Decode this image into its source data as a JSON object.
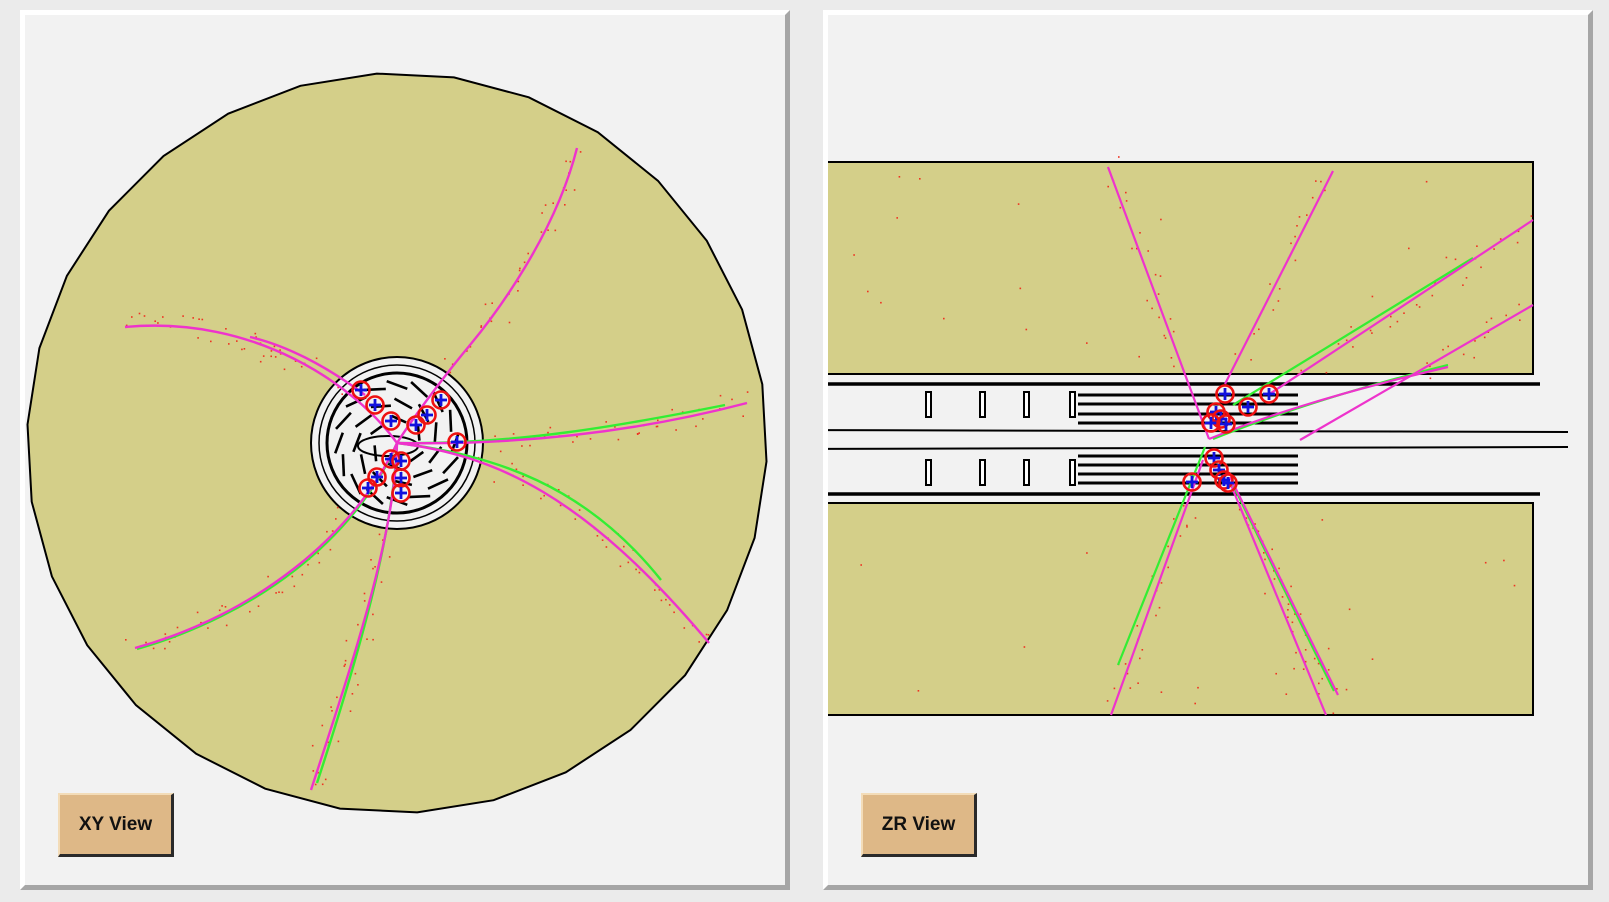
{
  "xy_view": {
    "label": "XY View"
  },
  "zr_view": {
    "label": "ZR View"
  },
  "colors": {
    "background": "#f2f2f2",
    "calorimeter": "#d4cf89",
    "reco_track": "#ee33cc",
    "mc_track": "#33ee33",
    "hit": "#ee3322",
    "vertex_ring": "#ee1111",
    "vertex_cross": "#1111dd",
    "label_button": "#deb887"
  },
  "icons": {
    "vertex": "vertex-cross-circle-icon"
  }
}
